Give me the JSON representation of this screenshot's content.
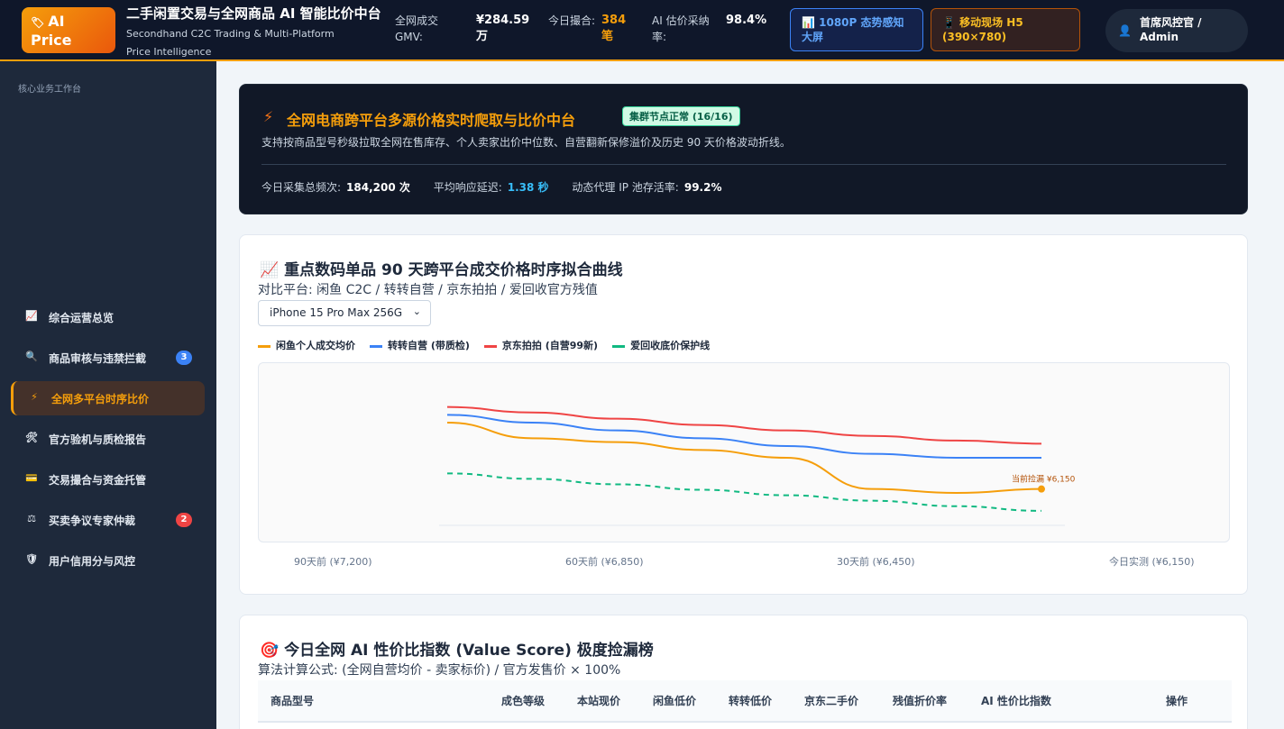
{
  "header": {
    "logo_icon": "tag-icon",
    "logo_text": "AI Price",
    "title": "二手闲置交易与全网商品 AI 智能比价中台",
    "subtitle": "Secondhand C2C Trading & Multi-Platform Price Intelligence",
    "kpis": [
      {
        "label": "全网成交 GMV:",
        "value": "¥284.59 万",
        "color": "#ffffff"
      },
      {
        "label": "今日撮合:",
        "value": "384 笔",
        "color": "#f59e0b"
      },
      {
        "label": "AI 估价采纳率:",
        "value": "98.4%",
        "color": "#ffffff"
      }
    ],
    "btn_dashboard": "📊 1080P 态势感知大屏",
    "btn_h5": "📱 移动现场 H5 (390×780)",
    "user": "首席风控官 / Admin"
  },
  "sidebar": {
    "heading": "核心业务工作台",
    "items": [
      {
        "label": "综合运营总览",
        "icon": "📈"
      },
      {
        "label": "商品审核与违禁拦截",
        "icon": "🔍",
        "badge": "3",
        "badge_color": "#3b82f6"
      },
      {
        "label": "全网多平台时序比价",
        "icon": "⚡",
        "active": true
      },
      {
        "label": "官方验机与质检报告",
        "icon": "🛠"
      },
      {
        "label": "交易撮合与资金托管",
        "icon": "💳"
      },
      {
        "label": "买卖争议专家仲裁",
        "icon": "⚖",
        "badge": "2",
        "badge_color": "#ef4444"
      },
      {
        "label": "用户信用分与风控",
        "icon": "🛡"
      }
    ]
  },
  "hero": {
    "title": "全网电商跨平台多源价格实时爬取与比价中台",
    "status": "集群节点正常 (16/16)",
    "desc": "支持按商品型号秒级拉取全网在售库存、个人卖家出价中位数、自营翻新保修溢价及历史 90 天价格波动折线。",
    "stats": [
      {
        "label": "今日采集总频次:",
        "value": "184,200 次"
      },
      {
        "label": "平均响应延迟:",
        "value": "1.38 秒"
      },
      {
        "label": "动态代理 IP 池存活率:",
        "value": "99.2%"
      }
    ]
  },
  "trend_card": {
    "title": "📈 重点数码单品 90 天跨平台成交价格时序拟合曲线",
    "subtitle": "对比平台: 闲鱼 C2C / 转转自营 / 京东拍拍 / 爱回收官方残值",
    "select_value": "iPhone 15 Pro Max 256G",
    "annotation": "当前捡漏 ¥6,150"
  },
  "chart_data": {
    "type": "line",
    "x": [
      "90天前 (¥7,200)",
      "60天前 (¥6,850)",
      "30天前 (¥6,450)",
      "今日实测 (¥6,150)"
    ],
    "series": [
      {
        "name": "闲鱼个人成交均价",
        "color": "#f59e0b",
        "style": "solid",
        "values": [
          7150,
          6950,
          6900,
          6800,
          6700,
          6300,
          6250,
          6300
        ]
      },
      {
        "name": "转转自营 (带质检)",
        "color": "#3b82f6",
        "style": "solid",
        "values": [
          7250,
          7150,
          7050,
          6950,
          6850,
          6750,
          6700,
          6700
        ]
      },
      {
        "name": "京东拍拍 (自营99新)",
        "color": "#ef4444",
        "style": "solid",
        "values": [
          7350,
          7280,
          7200,
          7120,
          7050,
          6980,
          6920,
          6880
        ]
      },
      {
        "name": "爱回收底价保护线",
        "color": "#10b981",
        "style": "dashed",
        "values": [
          6500,
          6430,
          6360,
          6290,
          6220,
          6150,
          6080,
          6020
        ]
      }
    ],
    "grid": false,
    "legend": "top-left"
  },
  "value_card": {
    "title": "🎯 今日全网 AI 性价比指数 (Value Score) 极度捡漏榜",
    "formula": "算法计算公式: (全网自营均价 - 卖家标价) / 官方发售价 × 100%",
    "columns": [
      "商品型号",
      "成色等级",
      "本站现价",
      "闲鱼低价",
      "转转低价",
      "京东二手价",
      "残值折价率",
      "AI 性价比指数",
      "操作"
    ]
  }
}
